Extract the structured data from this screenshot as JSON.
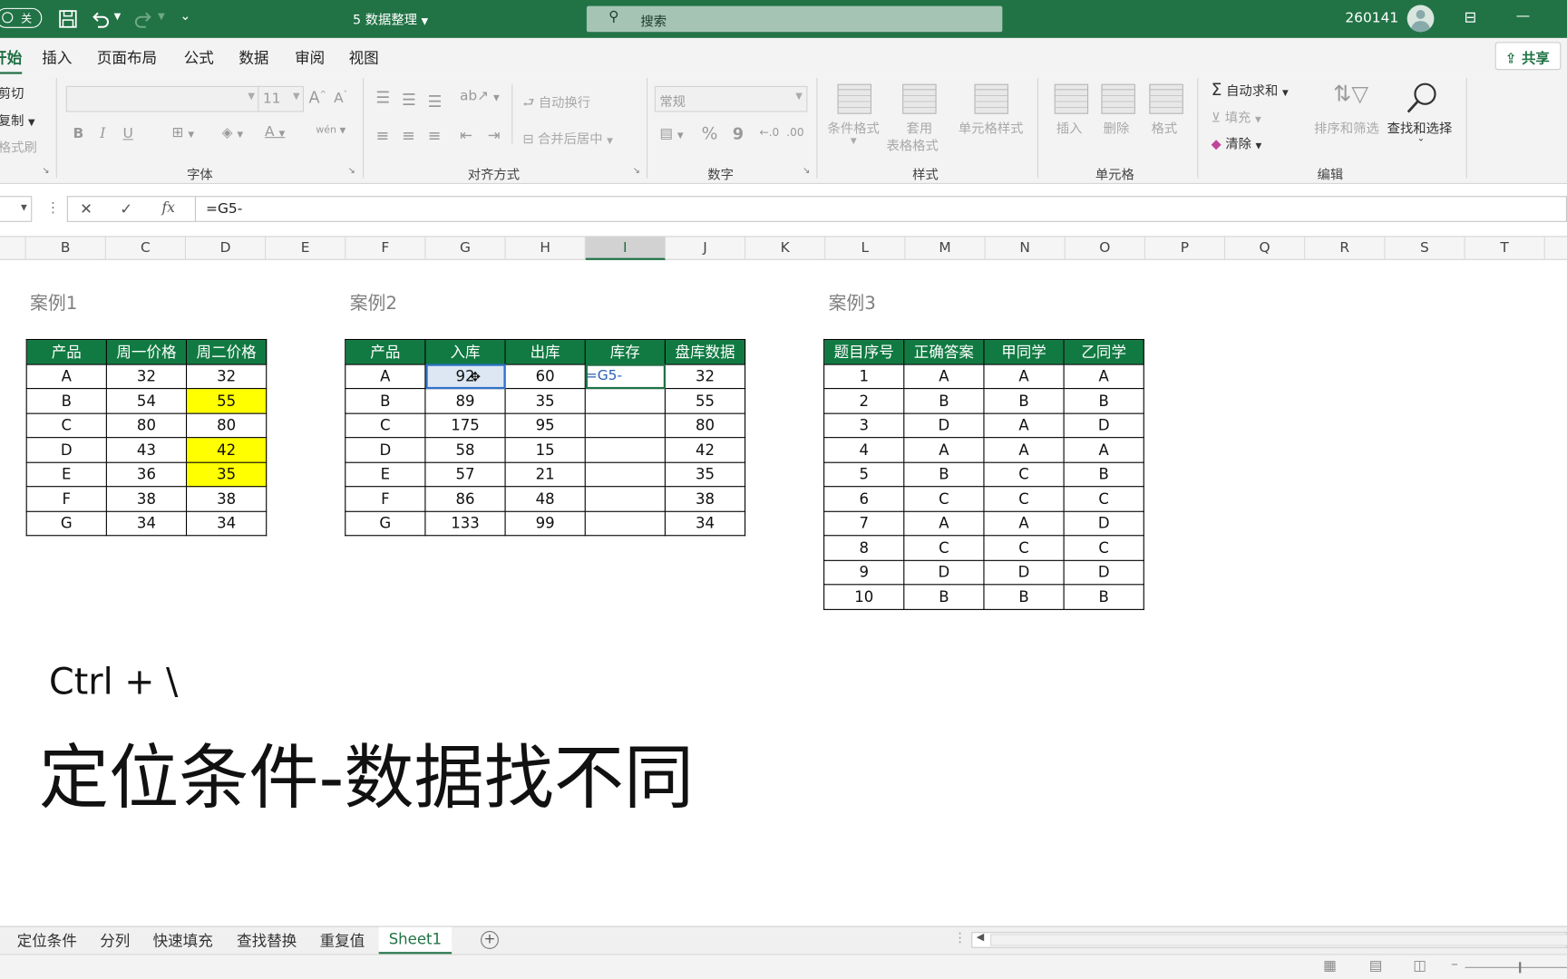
{
  "titlebar": {
    "toggle_label": "关",
    "doc_title": "5 数据整理",
    "search_placeholder": "搜索",
    "user_id": "260141",
    "restore_glyph": "⊟",
    "minimize_glyph": "—"
  },
  "menu": {
    "tabs": [
      "开始",
      "插入",
      "页面布局",
      "公式",
      "数据",
      "审阅",
      "视图"
    ],
    "share_label": "共享"
  },
  "ribbon": {
    "clipboard": {
      "cut": "剪切",
      "copy": "复制",
      "painter": "格式刷"
    },
    "font": {
      "name": "",
      "size": "11",
      "bold": "B",
      "italic": "I",
      "underline": "U",
      "group": "字体"
    },
    "alignment": {
      "wrap": "自动换行",
      "merge": "合并后居中",
      "group": "对齐方式"
    },
    "number": {
      "format": "常规",
      "percent": "%",
      "comma": "9",
      "group": "数字"
    },
    "styles": {
      "conditional": "条件格式",
      "table_line1": "套用",
      "table_line2": "表格格式",
      "cell_styles": "单元格样式",
      "group": "样式"
    },
    "cells": {
      "insert": "插入",
      "delete": "删除",
      "format": "格式",
      "group": "单元格"
    },
    "editing": {
      "autosum": "自动求和",
      "fill": "填充",
      "clear": "清除",
      "sort": "排序和筛选",
      "find": "查找和选择",
      "group": "编辑"
    }
  },
  "formula_bar": {
    "formula": "=G5-",
    "cancel": "✕",
    "confirm": "✓",
    "fx": "fx"
  },
  "columns": [
    "B",
    "C",
    "D",
    "E",
    "F",
    "G",
    "H",
    "I",
    "J",
    "K",
    "L",
    "M",
    "N",
    "O",
    "P",
    "Q",
    "R",
    "S",
    "T"
  ],
  "selected_column": "I",
  "case1": {
    "label": "案例1",
    "headers": [
      "产品",
      "周一价格",
      "周二价格"
    ],
    "rows": [
      [
        "A",
        "32",
        "32"
      ],
      [
        "B",
        "54",
        "55"
      ],
      [
        "C",
        "80",
        "80"
      ],
      [
        "D",
        "43",
        "42"
      ],
      [
        "E",
        "36",
        "35"
      ],
      [
        "F",
        "38",
        "38"
      ],
      [
        "G",
        "34",
        "34"
      ]
    ],
    "highlight_color": "#ffff00"
  },
  "case2": {
    "label": "案例2",
    "headers": [
      "产品",
      "入库",
      "出库",
      "库存",
      "盘库数据"
    ],
    "rows": [
      [
        "A",
        "92",
        "60",
        "=G5-",
        "32"
      ],
      [
        "B",
        "89",
        "35",
        "",
        "55"
      ],
      [
        "C",
        "175",
        "95",
        "",
        "80"
      ],
      [
        "D",
        "58",
        "15",
        "",
        "42"
      ],
      [
        "E",
        "57",
        "21",
        "",
        "35"
      ],
      [
        "F",
        "86",
        "48",
        "",
        "38"
      ],
      [
        "G",
        "133",
        "99",
        "",
        "34"
      ]
    ]
  },
  "case3": {
    "label": "案例3",
    "headers": [
      "题目序号",
      "正确答案",
      "甲同学",
      "乙同学"
    ],
    "rows": [
      [
        "1",
        "A",
        "A",
        "A"
      ],
      [
        "2",
        "B",
        "B",
        "B"
      ],
      [
        "3",
        "D",
        "A",
        "D"
      ],
      [
        "4",
        "A",
        "A",
        "A"
      ],
      [
        "5",
        "B",
        "C",
        "B"
      ],
      [
        "6",
        "C",
        "C",
        "C"
      ],
      [
        "7",
        "A",
        "A",
        "D"
      ],
      [
        "8",
        "C",
        "C",
        "C"
      ],
      [
        "9",
        "D",
        "D",
        "D"
      ],
      [
        "10",
        "B",
        "B",
        "B"
      ]
    ]
  },
  "overlay": {
    "shortcut": "Ctrl + \\",
    "caption": "定位条件-数据找不同"
  },
  "sheet_tabs": [
    "定位条件",
    "分列",
    "快速填充",
    "查找替换",
    "重复值",
    "Sheet1"
  ],
  "active_sheet": "Sheet1",
  "add_sheet": "+",
  "colors": {
    "excel_green": "#217346",
    "header_green": "#117a42",
    "highlight": "#ffff00"
  }
}
